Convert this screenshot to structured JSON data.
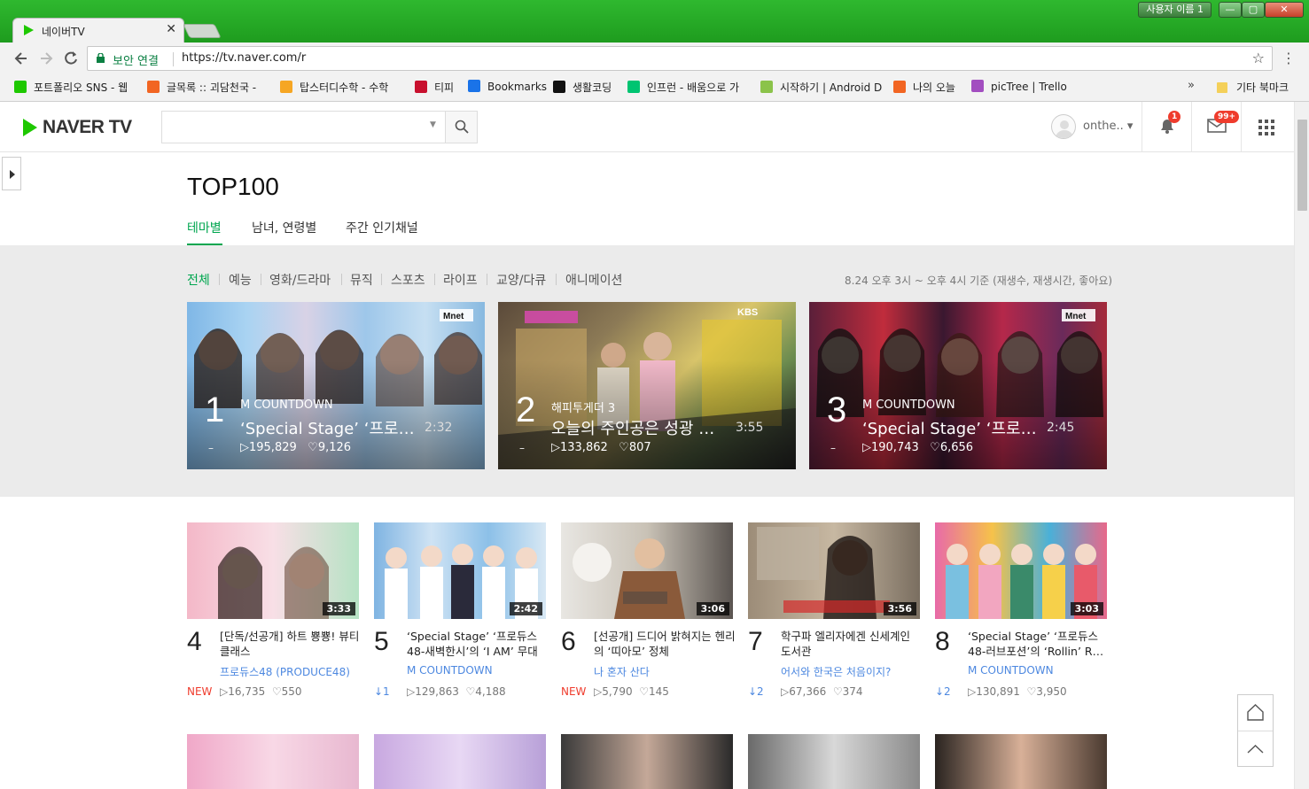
{
  "window": {
    "user_label": "사용자 이름 1",
    "min": "—",
    "max": "▢",
    "close": "✕"
  },
  "tab": {
    "title": "네이버TV",
    "close": "✕"
  },
  "omnibox": {
    "secure_label": "보안 연결",
    "url": "https://tv.naver.com/r"
  },
  "bookmarks": [
    {
      "label": "포트폴리오 SNS - 웹",
      "color": "#1ec800"
    },
    {
      "label": "글목록 :: 괴담천국 -",
      "color": "#f26522"
    },
    {
      "label": "탑스터디수학 - 수학",
      "color": "#f6a623"
    },
    {
      "label": "티피",
      "color": "#c8102e"
    },
    {
      "label": "Bookmarks",
      "color": "#1a73e8"
    },
    {
      "label": "생활코딩",
      "color": "#111111"
    },
    {
      "label": "인프런 - 배움으로 가",
      "color": "#00c471"
    },
    {
      "label": "시작하기 | Android D",
      "color": "#8bc34a"
    },
    {
      "label": "나의 오늘",
      "color": "#f26522"
    },
    {
      "label": "picTree | Trello",
      "color": "#a24ec0"
    }
  ],
  "bookmarks_more": "»",
  "bookmarks_other": "기타 북마크",
  "header": {
    "logo": "NAVER TV",
    "username": "onthe.. ▾",
    "bell_badge": "1",
    "mail_badge": "99+"
  },
  "page": {
    "title": "TOP100",
    "tabs": [
      "테마별",
      "남녀, 연령별",
      "주간 인기채널"
    ],
    "categories": [
      "전체",
      "예능",
      "영화/드라마",
      "뮤직",
      "스포츠",
      "라이프",
      "교양/다큐",
      "애니메이션"
    ],
    "basis": "8.24 오후 3시 ~ 오후 4시 기준 (재생수, 재생시간, 좋아요)"
  },
  "top3": [
    {
      "rank": "1",
      "channel": "M COUNTDOWN",
      "title": "‘Special Stage’ ‘프로…",
      "duration": "2:32",
      "plays": "▷195,829",
      "likes": "♡9,126",
      "dash": "–"
    },
    {
      "rank": "2",
      "channel": "해피투게더 3",
      "title": "오늘의 주인공은 성광 …",
      "duration": "3:55",
      "plays": "▷133,862",
      "likes": "♡807",
      "dash": "–"
    },
    {
      "rank": "3",
      "channel": "M COUNTDOWN",
      "title": "‘Special Stage’ ‘프로…",
      "duration": "2:45",
      "plays": "▷190,743",
      "likes": "♡6,656",
      "dash": "–"
    }
  ],
  "list": [
    {
      "rank": "4",
      "title": "[단독/선공개] 하트 뿅뿅! 뷰티 클래스",
      "channel": "프로듀스48 (PRODUCE48)",
      "change": "NEW",
      "plays": "▷16,735",
      "likes": "♡550",
      "duration": "3:33"
    },
    {
      "rank": "5",
      "title": "‘Special Stage’ ‘프로듀스48-새벽한시’의 ‘I AM’ 무대",
      "channel": "M COUNTDOWN",
      "change": "↓1",
      "plays": "▷129,863",
      "likes": "♡4,188",
      "duration": "2:42"
    },
    {
      "rank": "6",
      "title": "[선공개] 드디어 밝혀지는 헨리의 ‘띠아모’ 정체",
      "channel": "나 혼자 산다",
      "change": "NEW",
      "plays": "▷5,790",
      "likes": "♡145",
      "duration": "3:06"
    },
    {
      "rank": "7",
      "title": "학구파 엘리자에겐 신세계인 도서관",
      "channel": "어서와 한국은 처음이지?",
      "change": "↓2",
      "plays": "▷67,366",
      "likes": "♡374",
      "duration": "3:56"
    },
    {
      "rank": "8",
      "title": "‘Special Stage’ ‘프로듀스48-러브포션’의 ‘Rollin’ R…",
      "channel": "M COUNTDOWN",
      "change": "↓2",
      "plays": "▷130,891",
      "likes": "♡3,950",
      "duration": "3:03"
    }
  ]
}
